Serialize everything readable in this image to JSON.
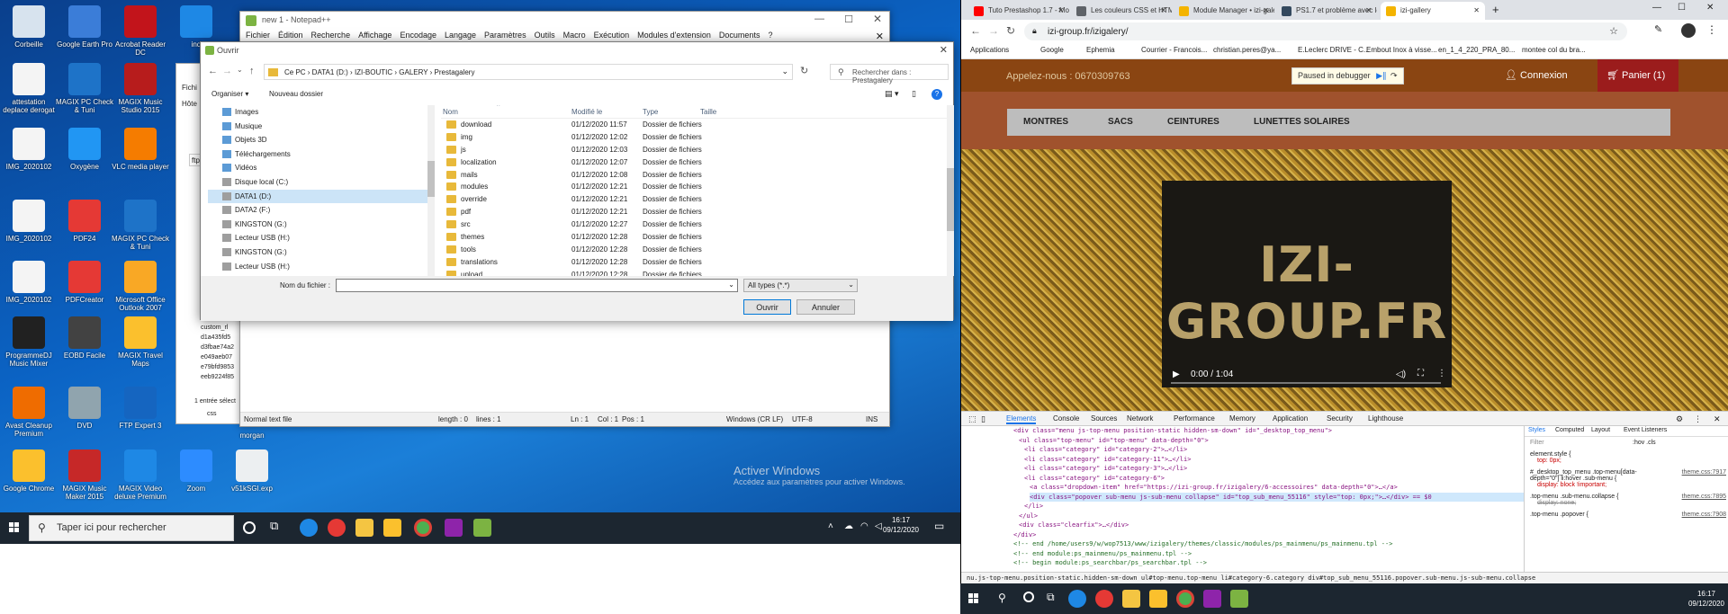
{
  "desktop": {
    "icons": [
      {
        "label": "Corbeille",
        "color": "#d7e3ee"
      },
      {
        "label": "Google Earth Pro",
        "color": "#3b7dd8"
      },
      {
        "label": "Acrobat Reader DC",
        "color": "#c2141b"
      },
      {
        "label": "ind",
        "color": "#1e88e5"
      },
      {
        "label": "attestation deplace derogat",
        "color": "#f4f4f4"
      },
      {
        "label": "MAGIX PC Check & Tuni",
        "color": "#1e73c8"
      },
      {
        "label": "MAGIX Music Studio 2015",
        "color": "#b71c1c"
      },
      {
        "label": "IMG_2020102",
        "color": "#f4f4f4"
      },
      {
        "label": "Oxygène",
        "color": "#2196f3"
      },
      {
        "label": "VLC media player",
        "color": "#f57c00"
      },
      {
        "label": "IMG_2020102",
        "color": "#f4f4f4"
      },
      {
        "label": "PDF24",
        "color": "#e53935"
      },
      {
        "label": "MAGIX PC Check & Tuni",
        "color": "#1e73c8"
      },
      {
        "label": "IMG_2020102",
        "color": "#f4f4f4"
      },
      {
        "label": "PDFCreator",
        "color": "#e53935"
      },
      {
        "label": "Microsoft Office Outlook 2007",
        "color": "#f9a825"
      },
      {
        "label": "ProgrammeDJ Music Mixer",
        "color": "#212121"
      },
      {
        "label": "EOBD Facile",
        "color": "#424242"
      },
      {
        "label": "MAGIX Travel Maps",
        "color": "#fbc02d"
      },
      {
        "label": "Avast Cleanup Premium",
        "color": "#ef6c00"
      },
      {
        "label": "DVD",
        "color": "#90a4ae"
      },
      {
        "label": "FTP Expert 3",
        "color": "#1565c0"
      },
      {
        "label": "Google Chrome",
        "color": "#fbc02d"
      },
      {
        "label": "MAGIX Music Maker 2015",
        "color": "#c62828"
      },
      {
        "label": "MAGIX Video deluxe Premium",
        "color": "#1e88e5"
      },
      {
        "label": "Zoom",
        "color": "#2d8cff"
      },
      {
        "label": "v51kSGI.exp",
        "color": "#eceff1"
      },
      {
        "label": "morgan",
        "color": "#eceff1"
      }
    ],
    "watermark_title": "Activer Windows",
    "watermark_text": "Accédez aux paramètres pour activer Windows.",
    "side_label": "dier"
  },
  "taskbar_left": {
    "search_placeholder": "Taper ici pour rechercher",
    "time": "16:17",
    "date": "09/12/2020"
  },
  "notepad": {
    "title": "new 1 - Notepad++",
    "menu": [
      "Fichier",
      "Édition",
      "Recherche",
      "Affichage",
      "Encodage",
      "Langage",
      "Paramètres",
      "Outils",
      "Macro",
      "Exécution",
      "Modules d'extension",
      "Documents",
      "?"
    ],
    "status": {
      "type": "Normal text file",
      "length": "length : 0",
      "lines": "lines : 1",
      "ln": "Ln : 1",
      "col": "Col : 1",
      "pos": "Pos : 1",
      "eol": "Windows (CR LF)",
      "enc": "UTF-8",
      "ins": "INS"
    }
  },
  "explorer_behind": {
    "tabs": [
      "Fichi",
      "Hôte"
    ],
    "path": "ftp",
    "items": [
      "custom_rl",
      "d1a435fd5",
      "d3fbae74a2",
      "e049aeb07",
      "e79bfd9853",
      "eeb9224f85"
    ],
    "selection": "1 entrée sélect",
    "folder": "css"
  },
  "dialog": {
    "title": "Ouvrir",
    "path": [
      "Ce PC",
      "DATA1 (D:)",
      "IZI-BOUTIC",
      "GALERY",
      "Prestagalery"
    ],
    "search_placeholder": "Rechercher dans : Prestagalery",
    "organize": "Organiser",
    "new_folder": "Nouveau dossier",
    "nav": [
      {
        "label": "Images",
        "selected": false
      },
      {
        "label": "Musique",
        "selected": false
      },
      {
        "label": "Objets 3D",
        "selected": false
      },
      {
        "label": "Téléchargements",
        "selected": false
      },
      {
        "label": "Vidéos",
        "selected": false
      },
      {
        "label": "Disque local (C:)",
        "selected": false
      },
      {
        "label": "DATA1 (D:)",
        "selected": true
      },
      {
        "label": "DATA2 (F:)",
        "selected": false
      },
      {
        "label": "KINGSTON (G:)",
        "selected": false
      },
      {
        "label": "Lecteur USB (H:)",
        "selected": false
      },
      {
        "label": "KINGSTON (G:)",
        "selected": false
      },
      {
        "label": "Lecteur USB (H:)",
        "selected": false
      }
    ],
    "columns": {
      "name": "Nom",
      "modified": "Modifié le",
      "type": "Type",
      "size": "Taille"
    },
    "files": [
      {
        "name": "download",
        "date": "01/12/2020 11:57",
        "type": "Dossier de fichiers"
      },
      {
        "name": "img",
        "date": "01/12/2020 12:02",
        "type": "Dossier de fichiers"
      },
      {
        "name": "js",
        "date": "01/12/2020 12:03",
        "type": "Dossier de fichiers"
      },
      {
        "name": "localization",
        "date": "01/12/2020 12:07",
        "type": "Dossier de fichiers"
      },
      {
        "name": "mails",
        "date": "01/12/2020 12:08",
        "type": "Dossier de fichiers"
      },
      {
        "name": "modules",
        "date": "01/12/2020 12:21",
        "type": "Dossier de fichiers"
      },
      {
        "name": "override",
        "date": "01/12/2020 12:21",
        "type": "Dossier de fichiers"
      },
      {
        "name": "pdf",
        "date": "01/12/2020 12:21",
        "type": "Dossier de fichiers"
      },
      {
        "name": "src",
        "date": "01/12/2020 12:27",
        "type": "Dossier de fichiers"
      },
      {
        "name": "themes",
        "date": "01/12/2020 12:28",
        "type": "Dossier de fichiers"
      },
      {
        "name": "tools",
        "date": "01/12/2020 12:28",
        "type": "Dossier de fichiers"
      },
      {
        "name": "translations",
        "date": "01/12/2020 12:28",
        "type": "Dossier de fichiers"
      },
      {
        "name": "upload",
        "date": "01/12/2020 12:28",
        "type": "Dossier de fichiers"
      }
    ],
    "filename_label": "Nom du fichier :",
    "filename_value": "",
    "filetype": "All types (*.*)",
    "open": "Ouvrir",
    "cancel": "Annuler"
  },
  "chrome": {
    "tabs": [
      {
        "title": "Tuto Prestashop 1.7 - Mod",
        "color": "#ff0000"
      },
      {
        "title": "Les couleurs CSS et HTML",
        "color": "#5f6368"
      },
      {
        "title": "Module Manager • izi-gale",
        "color": "#f4b400"
      },
      {
        "title": "PS1.7 et problème avec le",
        "color": "#34495e"
      },
      {
        "title": "izi-gallery",
        "color": "#f4b400"
      }
    ],
    "url": "izi-group.fr/izigalery/",
    "bookmarks": [
      "Applications",
      "Google",
      "Ephemia",
      "Courrier - Francois...",
      "christian.peres@ya...",
      "E.Leclerc DRIVE - C...",
      "Embout Inox à visse...",
      "en_1_4_220_PRA_80...",
      "montee col du bra..."
    ]
  },
  "site": {
    "phone": "Appelez-nous : 0670309763",
    "debugger": "Paused in debugger",
    "login": "Connexion",
    "cart": "Panier (1)",
    "nav": [
      "MONTRES",
      "SACS",
      "CEINTURES",
      "LUNETTES SOLAIRES"
    ],
    "logo": "IZI-GROUP.FR",
    "time": "0:00 / 1:04"
  },
  "devtools": {
    "tabs": [
      "Elements",
      "Console",
      "Sources",
      "Network",
      "Performance",
      "Memory",
      "Application",
      "Security",
      "Lighthouse"
    ],
    "code": [
      "<div class=\"menu js-top-menu position-static hidden-sm-down\" id=\"_desktop_top_menu\">",
      "<ul class=\"top-menu\" id=\"top-menu\" data-depth=\"0\">",
      "<li class=\"category\" id=\"category-2\">…</li>",
      "<li class=\"category\" id=\"category-11\">…</li>",
      "<li class=\"category\" id=\"category-3\">…</li>",
      "<li class=\"category\" id=\"category-6\">",
      "<a class=\"dropdown-item\" href=\"https://izi-group.fr/izigalery/6-accessoires\" data-depth=\"0\">…</a>",
      "<div class=\"popover sub-menu js-sub-menu collapse\" id=\"top_sub_menu_55116\" style=\"top: 0px;\">…</div> == $0",
      "</li>",
      "</ul>",
      "<div class=\"clearfix\">…</div>",
      "</div>",
      "<!-- end /home/users9/w/wop7513/www/izigalery/themes/classic/modules/ps_mainmenu/ps_mainmenu.tpl -->",
      "<!-- end module:ps_mainmenu/ps_mainmenu.tpl -->",
      "<!-- begin module:ps_searchbar/ps_searchbar.tpl -->"
    ],
    "styles_tabs": [
      "Styles",
      "Computed",
      "Layout",
      "Event Listeners"
    ],
    "filter": "Filter",
    "hov": ":hov .cls",
    "rules": [
      {
        "selector": "element.style {",
        "prop": "top: 0px;",
        "file": ""
      },
      {
        "selector": "#_desktop_top_menu .top-menu[data-depth=\"0\"] li:hover .sub-menu {",
        "prop": "display: block !important;",
        "file": "theme.css:7917"
      },
      {
        "selector": ".top-menu .sub-menu.collapse {",
        "prop": "display: none;",
        "file": "theme.css:7895"
      },
      {
        "selector": ".top-menu .popover {",
        "prop": "",
        "file": "theme.css:7908"
      }
    ],
    "breadcrumbs": "nu.js-top-menu.position-static.hidden-sm-down   ul#top-menu.top-menu   li#category-6.category   div#top_sub_menu_55116.popover.sub-menu.js-sub-menu.collapse"
  },
  "taskbar_right": {
    "time": "16:17",
    "date": "09/12/2020"
  }
}
